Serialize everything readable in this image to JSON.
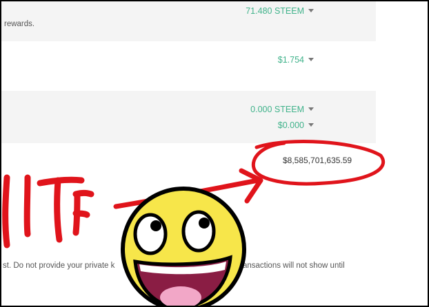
{
  "rewards": {
    "steem_value": "71.480 STEEM",
    "note": "rewards."
  },
  "balance": {
    "usd_value": "$1.754"
  },
  "savings": {
    "steem_value": "0.000 STEEM",
    "usd_value": "$0.000"
  },
  "estimated_value": "$8,585,701,635.59",
  "footer_note": {
    "left": "st. Do not provide your private k",
    "right": "ansactions will not show until"
  },
  "annotation_text": "WTF",
  "colors": {
    "accent": "#3fb28a",
    "panel": "#f4f4f4",
    "marker": "#e0141b",
    "face": "#f7e64a"
  }
}
